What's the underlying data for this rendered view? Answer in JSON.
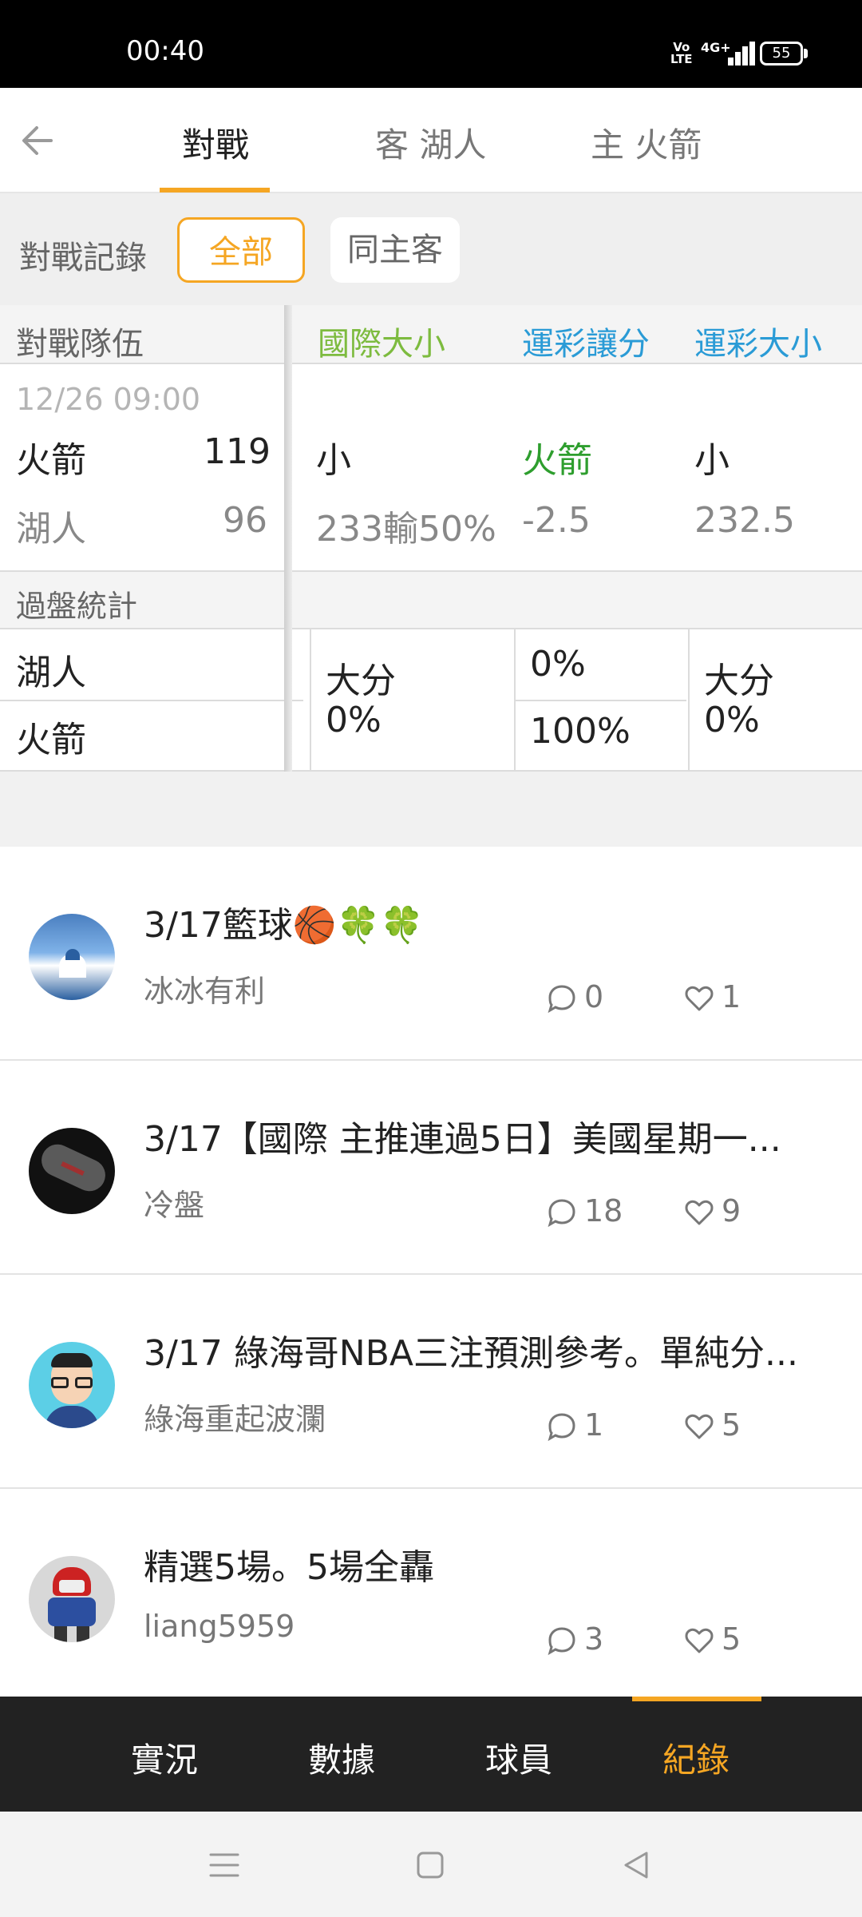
{
  "status_bar": {
    "time": "00:40",
    "volte": "Vo LTE",
    "network": "4G+",
    "battery": "55"
  },
  "tabs": {
    "active": "對戰",
    "away": "客 湖人",
    "home": "主 火箭"
  },
  "filter": {
    "label": "對戰記錄",
    "option_all": "全部",
    "option_same": "同主客"
  },
  "table": {
    "headers": {
      "teams": "對戰隊伍",
      "intl_ou": "國際大小",
      "lottery_spread": "運彩讓分",
      "lottery_ou": "運彩大小"
    },
    "game": {
      "datetime": "12/26 09:00",
      "home_team": "火箭",
      "home_score": "119",
      "away_team": "湖人",
      "away_score": "96",
      "intl_ou_result": "小",
      "intl_ou_line": "233輸50%",
      "spread_result": "火箭",
      "spread_line": "-2.5",
      "lottery_ou_result": "小",
      "lottery_ou_line": "232.5"
    },
    "stats": {
      "label": "過盤統計",
      "team1": "湖人",
      "team2": "火箭",
      "intl_ou_label": "大分",
      "intl_ou_pct": "0%",
      "spread_team1_pct": "0%",
      "spread_team2_pct": "100%",
      "lottery_ou_label": "大分",
      "lottery_ou_pct": "0%"
    }
  },
  "posts": [
    {
      "title": "3/17籃球🏀🍀🍀",
      "author": "冰冰有利",
      "comments": "0",
      "likes": "1"
    },
    {
      "title": "3/17【國際 主推連過5日】美國星期一...",
      "author": "冷盤",
      "comments": "18",
      "likes": "9"
    },
    {
      "title": "3/17 綠海哥NBA三注預測參考。單純分...",
      "author": "綠海重起波瀾",
      "comments": "1",
      "likes": "5"
    },
    {
      "title": "精選5場。5場全轟",
      "author": "liang5959",
      "comments": "3",
      "likes": "5"
    }
  ],
  "bottom_nav": {
    "live": "實況",
    "data": "數據",
    "players": "球員",
    "records": "紀錄"
  },
  "colors": {
    "accent": "#f5a623",
    "intl_header": "#7dbb3f",
    "lottery_header": "#2a9bd6",
    "win_green": "#2e9e2e"
  },
  "icons": [
    "back-arrow-icon",
    "comment-icon",
    "heart-icon",
    "menu-icon",
    "home-square-icon",
    "back-triangle-icon"
  ]
}
